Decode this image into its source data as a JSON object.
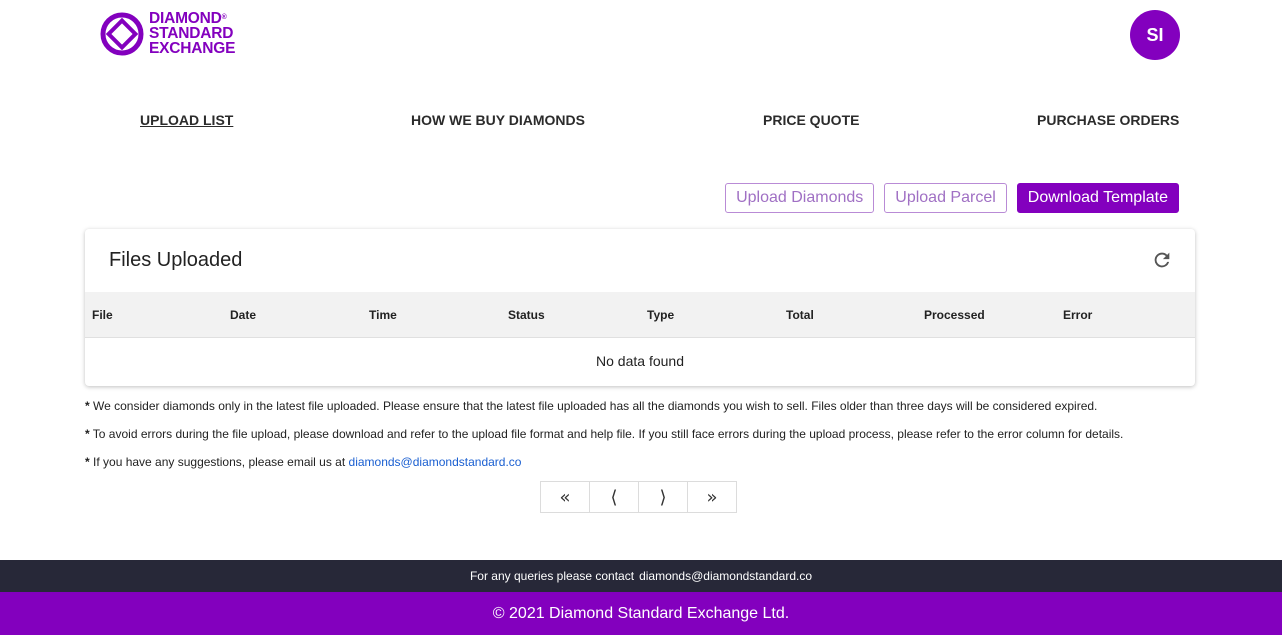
{
  "brand": {
    "line1": "DIAMOND",
    "reg": "®",
    "line2": "STANDARD",
    "line3": "EXCHANGE",
    "color": "#8300be"
  },
  "user": {
    "initials": "SI"
  },
  "nav": {
    "items": [
      {
        "label": "UPLOAD LIST",
        "active": true
      },
      {
        "label": "HOW WE BUY DIAMONDS",
        "active": false
      },
      {
        "label": "PRICE QUOTE",
        "active": false
      },
      {
        "label": "PURCHASE ORDERS",
        "active": false
      }
    ]
  },
  "actions": {
    "upload_diamonds": "Upload Diamonds",
    "upload_parcel": "Upload Parcel",
    "download_template": "Download Template"
  },
  "files_card": {
    "title": "Files Uploaded",
    "refresh_icon": "refresh-icon",
    "columns": [
      "File",
      "Date",
      "Time",
      "Status",
      "Type",
      "Total",
      "Processed",
      "Error"
    ],
    "rows": [],
    "empty_text": "No data found"
  },
  "notes": {
    "bullet": "*",
    "note1": "We consider diamonds only in the latest file uploaded. Please ensure that the latest file uploaded has all the diamonds you wish to sell. Files older than three days will be considered expired.",
    "note2": "To avoid errors during the file upload, please download and refer to the upload file format and help file. If you still face errors during the upload process, please refer to the error column for details.",
    "note3_prefix": "If you have any suggestions, please email us at",
    "note3_email": "diamonds@diamondstandard.co"
  },
  "pagination": {
    "first": "«",
    "prev": "⟨",
    "next": "⟩",
    "last": "»"
  },
  "footer": {
    "contact_prefix": "For any queries please contact",
    "contact_email": "diamonds@diamondstandard.co",
    "copyright": "© 2021 Diamond Standard Exchange Ltd.",
    "dark_color": "#272838"
  }
}
